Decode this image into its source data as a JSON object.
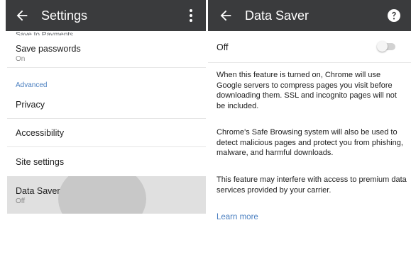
{
  "settings_screen": {
    "title": "Settings",
    "cut_off_item": "Save to Payments",
    "items": [
      {
        "label": "Save passwords",
        "sub": "On"
      },
      {
        "label": "Privacy"
      },
      {
        "label": "Accessibility"
      },
      {
        "label": "Site settings"
      },
      {
        "label": "Data Saver",
        "sub": "Off",
        "selected": true
      }
    ],
    "section_header": "Advanced"
  },
  "data_saver_screen": {
    "title": "Data Saver",
    "toggle": {
      "label": "Off",
      "on": false
    },
    "paragraphs": [
      "When this feature is turned on, Chrome will use Google servers to compress pages you visit before downloading them. SSL and incognito pages will not be included.",
      "Chrome's Safe Browsing system will also be used to detect malicious pages and protect you from phishing, malware, and harmful downloads.",
      "This feature may interfere with access to premium data services provided by your carrier."
    ],
    "learn_more": "Learn more"
  },
  "colors": {
    "app_bar": "#3a3b3d",
    "accent_link": "#4a7fc0",
    "selected_row": "#e0e0e0"
  },
  "icons": {
    "back": "arrow-back-icon",
    "overflow": "more-vert-icon",
    "help": "help-icon"
  }
}
